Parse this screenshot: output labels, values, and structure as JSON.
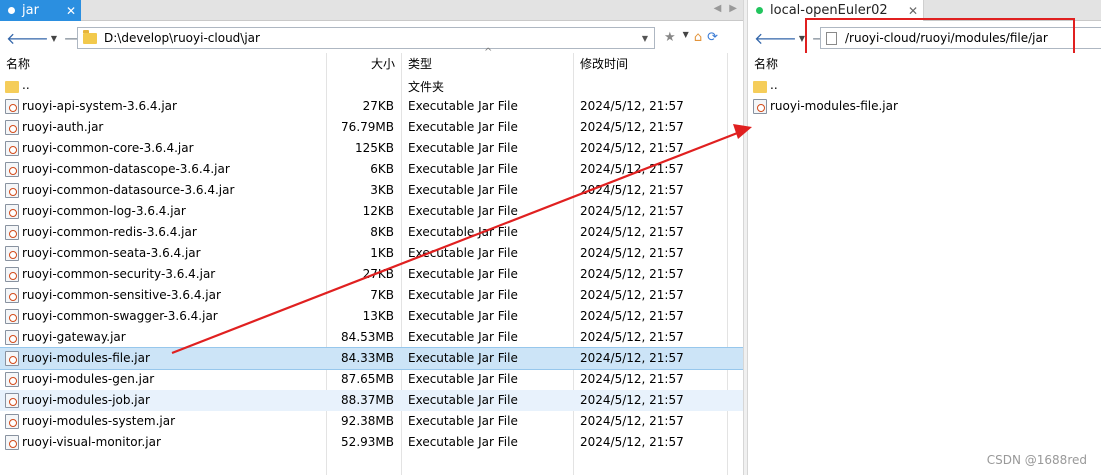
{
  "left_pane": {
    "tab_title": "jar",
    "path": "D:\\develop\\ruoyi-cloud\\jar",
    "columns": {
      "name": "名称",
      "size": "大小",
      "type": "类型",
      "modified": "修改时间"
    },
    "files": [
      {
        "name": "..",
        "size": "",
        "type": "文件夹",
        "modified": "",
        "icon": "folder-icon"
      },
      {
        "name": "ruoyi-api-system-3.6.4.jar",
        "size": "27KB",
        "type": "Executable Jar File",
        "modified": "2024/5/12, 21:57",
        "icon": "jar-file-icon"
      },
      {
        "name": "ruoyi-auth.jar",
        "size": "76.79MB",
        "type": "Executable Jar File",
        "modified": "2024/5/12, 21:57",
        "icon": "jar-file-icon"
      },
      {
        "name": "ruoyi-common-core-3.6.4.jar",
        "size": "125KB",
        "type": "Executable Jar File",
        "modified": "2024/5/12, 21:57",
        "icon": "jar-file-icon"
      },
      {
        "name": "ruoyi-common-datascope-3.6.4.jar",
        "size": "6KB",
        "type": "Executable Jar File",
        "modified": "2024/5/12, 21:57",
        "icon": "jar-file-icon"
      },
      {
        "name": "ruoyi-common-datasource-3.6.4.jar",
        "size": "3KB",
        "type": "Executable Jar File",
        "modified": "2024/5/12, 21:57",
        "icon": "jar-file-icon"
      },
      {
        "name": "ruoyi-common-log-3.6.4.jar",
        "size": "12KB",
        "type": "Executable Jar File",
        "modified": "2024/5/12, 21:57",
        "icon": "jar-file-icon"
      },
      {
        "name": "ruoyi-common-redis-3.6.4.jar",
        "size": "8KB",
        "type": "Executable Jar File",
        "modified": "2024/5/12, 21:57",
        "icon": "jar-file-icon"
      },
      {
        "name": "ruoyi-common-seata-3.6.4.jar",
        "size": "1KB",
        "type": "Executable Jar File",
        "modified": "2024/5/12, 21:57",
        "icon": "jar-file-icon"
      },
      {
        "name": "ruoyi-common-security-3.6.4.jar",
        "size": "27KB",
        "type": "Executable Jar File",
        "modified": "2024/5/12, 21:57",
        "icon": "jar-file-icon"
      },
      {
        "name": "ruoyi-common-sensitive-3.6.4.jar",
        "size": "7KB",
        "type": "Executable Jar File",
        "modified": "2024/5/12, 21:57",
        "icon": "jar-file-icon"
      },
      {
        "name": "ruoyi-common-swagger-3.6.4.jar",
        "size": "13KB",
        "type": "Executable Jar File",
        "modified": "2024/5/12, 21:57",
        "icon": "jar-file-icon"
      },
      {
        "name": "ruoyi-gateway.jar",
        "size": "84.53MB",
        "type": "Executable Jar File",
        "modified": "2024/5/12, 21:57",
        "icon": "jar-file-icon"
      },
      {
        "name": "ruoyi-modules-file.jar",
        "size": "84.33MB",
        "type": "Executable Jar File",
        "modified": "2024/5/12, 21:57",
        "icon": "jar-file-icon",
        "selected": true
      },
      {
        "name": "ruoyi-modules-gen.jar",
        "size": "87.65MB",
        "type": "Executable Jar File",
        "modified": "2024/5/12, 21:57",
        "icon": "jar-file-icon"
      },
      {
        "name": "ruoyi-modules-job.jar",
        "size": "88.37MB",
        "type": "Executable Jar File",
        "modified": "2024/5/12, 21:57",
        "icon": "jar-file-icon",
        "hover": true
      },
      {
        "name": "ruoyi-modules-system.jar",
        "size": "92.38MB",
        "type": "Executable Jar File",
        "modified": "2024/5/12, 21:57",
        "icon": "jar-file-icon"
      },
      {
        "name": "ruoyi-visual-monitor.jar",
        "size": "52.93MB",
        "type": "Executable Jar File",
        "modified": "2024/5/12, 21:57",
        "icon": "jar-file-icon"
      }
    ]
  },
  "right_pane": {
    "tab_title": "local-openEuler02",
    "path": "/ruoyi-cloud/ruoyi/modules/file/jar",
    "columns": {
      "name": "名称"
    },
    "files": [
      {
        "name": "..",
        "icon": "folder-icon"
      },
      {
        "name": "ruoyi-modules-file.jar",
        "icon": "jar-file-icon"
      }
    ]
  },
  "colors": {
    "tab_active": "#2b8fe0",
    "status_dot": "#22c55e",
    "annotation": "#e02020",
    "selection": "#cce4f7"
  },
  "watermark": "CSDN @1688red"
}
